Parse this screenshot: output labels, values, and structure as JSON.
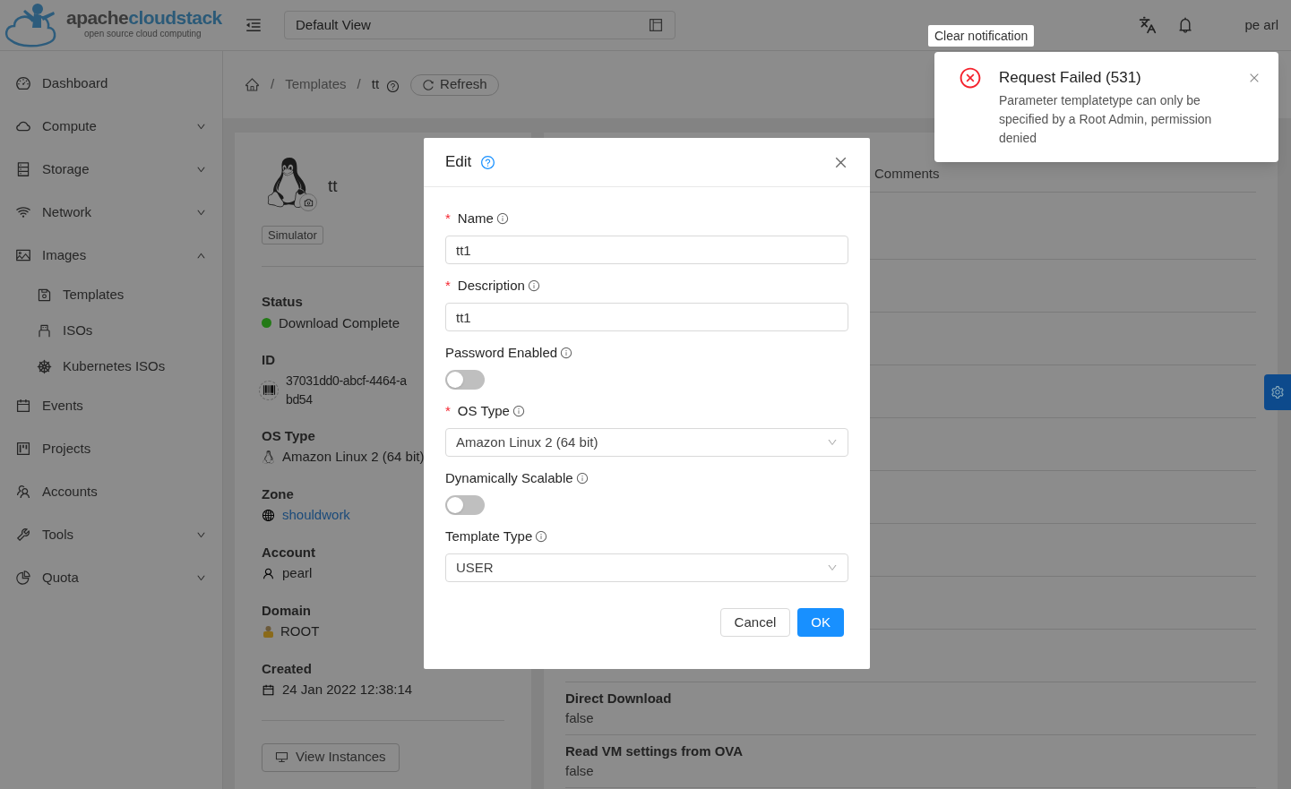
{
  "header": {
    "logo": {
      "prefix": "apache",
      "suffix": "cloudstack",
      "tagline": "open source cloud computing"
    },
    "view_select": {
      "value": "Default View"
    },
    "user": "pe arl"
  },
  "tooltip": {
    "text": "Clear notification"
  },
  "sidebar": {
    "items": [
      {
        "label": "Dashboard"
      },
      {
        "label": "Compute",
        "expanded": false
      },
      {
        "label": "Storage",
        "expanded": false
      },
      {
        "label": "Network",
        "expanded": false
      },
      {
        "label": "Images",
        "expanded": true,
        "children": [
          {
            "label": "Templates"
          },
          {
            "label": "ISOs"
          },
          {
            "label": "Kubernetes ISOs"
          }
        ]
      },
      {
        "label": "Events"
      },
      {
        "label": "Projects"
      },
      {
        "label": "Accounts"
      },
      {
        "label": "Tools",
        "expanded": false
      },
      {
        "label": "Quota",
        "expanded": false
      }
    ]
  },
  "breadcrumb": {
    "items": [
      "Templates",
      "tt"
    ],
    "separators": [
      "/",
      "/"
    ],
    "refresh": "Refresh"
  },
  "details": {
    "name": "tt",
    "tag": "Simulator",
    "fields": [
      {
        "label": "Status",
        "kind": "status",
        "value": "Download Complete",
        "color": "#237a16"
      },
      {
        "label": "ID",
        "kind": "id",
        "lines": [
          "37031dd0-abcf-4464-a",
          "bd54"
        ]
      },
      {
        "label": "OS Type",
        "kind": "os",
        "value": "Amazon Linux 2 (64 bit)"
      },
      {
        "label": "Zone",
        "kind": "link",
        "value": "shouldwork"
      },
      {
        "label": "Account",
        "kind": "user",
        "value": "pearl"
      },
      {
        "label": "Domain",
        "kind": "domain",
        "value": "ROOT"
      },
      {
        "label": "Created",
        "kind": "date",
        "value": "24 Jan 2022 12:38:14"
      }
    ],
    "button": "View Instances"
  },
  "info_panel": {
    "tab": "Comments",
    "rows": [
      {
        "label": "Direct Download",
        "value": "false"
      },
      {
        "label": "Read VM settings from OVA",
        "value": "false"
      }
    ]
  },
  "modal": {
    "title": "Edit",
    "fields": [
      {
        "kind": "input",
        "label": "Name",
        "required_mark": "*",
        "value": "tt1"
      },
      {
        "kind": "input",
        "label": "Description",
        "required_mark": "*",
        "value": "tt1"
      },
      {
        "kind": "switch",
        "label": "Password Enabled",
        "on": false
      },
      {
        "kind": "select",
        "label": "OS Type",
        "required_mark": "*",
        "value": "Amazon Linux 2 (64 bit)"
      },
      {
        "kind": "switch",
        "label": "Dynamically Scalable",
        "on": false
      },
      {
        "kind": "select",
        "label": "Template Type",
        "value": "USER"
      }
    ],
    "buttons": [
      {
        "label": "Cancel",
        "primary": false
      },
      {
        "label": "OK",
        "primary": true
      }
    ]
  },
  "notification": {
    "title": "Request Failed (531)",
    "message": "Parameter templatetype can only be specified by a Root Admin, permission denied"
  }
}
